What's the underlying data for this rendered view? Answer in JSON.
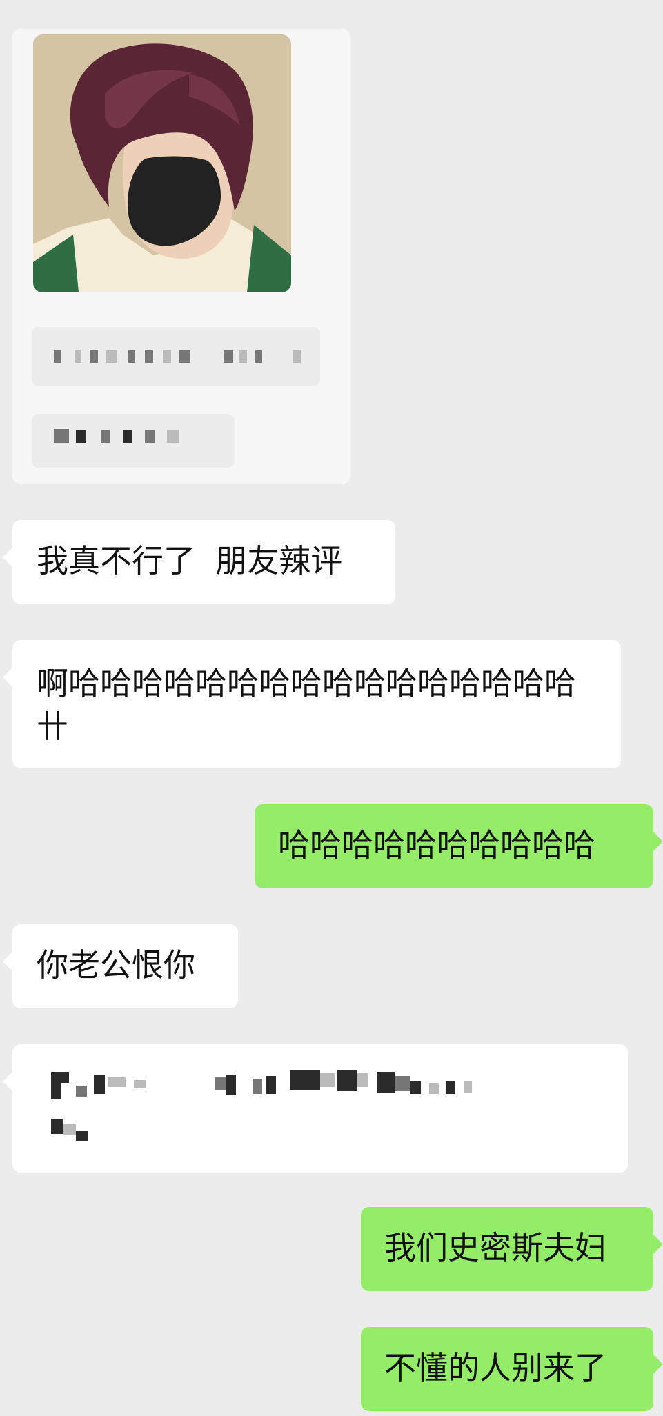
{
  "messages": [
    {
      "id": 1,
      "side": "left",
      "text": "我真不行了  朋友辣评"
    },
    {
      "id": 2,
      "side": "left",
      "text": "啊哈哈哈哈哈哈哈哈哈哈哈哈哈哈哈哈卄"
    },
    {
      "id": 3,
      "side": "right",
      "text": "哈哈哈哈哈哈哈哈哈哈"
    },
    {
      "id": 4,
      "side": "left",
      "text": "你老公恨你"
    },
    {
      "id": 5,
      "side": "left",
      "text": ""
    },
    {
      "id": 6,
      "side": "right",
      "text": "我们史密斯夫妇"
    },
    {
      "id": 7,
      "side": "right",
      "text": "不懂的人别来了"
    }
  ],
  "colors": {
    "background": "#ececec",
    "left_bubble": "#ffffff",
    "right_bubble": "#95ec69"
  }
}
